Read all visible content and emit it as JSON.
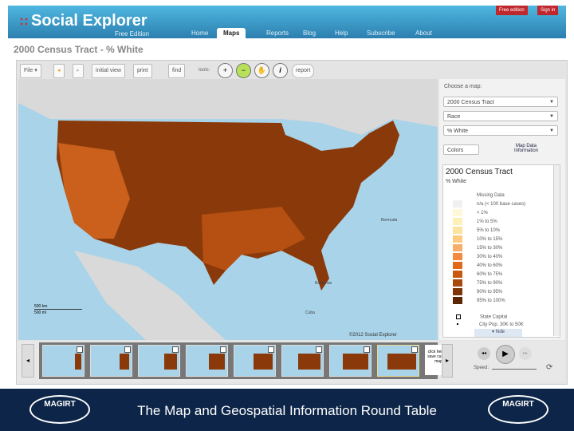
{
  "header": {
    "logo": "Social Explorer",
    "edition": "Free Edition",
    "nav": [
      "Home",
      "Maps",
      "Reports",
      "Blog",
      "Help",
      "Subscribe",
      "About"
    ],
    "active_nav": "Maps",
    "buttons": [
      "Free edition",
      "Sign in"
    ]
  },
  "page_title": "2000 Census Tract - % White",
  "toolbar": {
    "file": "File",
    "initial_view": "initial view",
    "print": "print",
    "find": "find",
    "tools": "tools:",
    "report": "report",
    "tools_icons": [
      "zoom-in-icon",
      "zoom-out-icon",
      "pan-hand-icon",
      "info-icon"
    ]
  },
  "map": {
    "labels": {
      "bermuda": "Bermuda",
      "bahamas": "Bahamas",
      "cuba": "Cuba",
      "scale_km": "500 km",
      "scale_mi": "500 mi",
      "copyright": "©2012 Social Explorer"
    },
    "colors": {
      "ocean": "#a9d3e8",
      "land": "#d9d9d9",
      "fill": "#8a3a0a"
    }
  },
  "side": {
    "choose": "Choose a map:",
    "selects": [
      "2000 Census Tract",
      "Race",
      "% White"
    ],
    "colors_btn": "Colors",
    "map_data_info": "Map Data Information",
    "legend": {
      "title": "2000 Census Tract",
      "subtitle": "% White",
      "items": [
        {
          "label": "Missing Data",
          "color": "#ffffff"
        },
        {
          "label": "n/a (< 100 base cases)",
          "color": "#f0f0f0"
        },
        {
          "label": "< 1%",
          "color": "#fff8d8"
        },
        {
          "label": "1% to 5%",
          "color": "#fff0b8"
        },
        {
          "label": "5% to 10%",
          "color": "#fde3a0"
        },
        {
          "label": "10% to 15%",
          "color": "#fccb80"
        },
        {
          "label": "15% to 30%",
          "color": "#f8ad68"
        },
        {
          "label": "30% to 40%",
          "color": "#f48a40"
        },
        {
          "label": "40% to 60%",
          "color": "#e06a18"
        },
        {
          "label": "60% to 75%",
          "color": "#c85a10"
        },
        {
          "label": "75% to 90%",
          "color": "#a84a0c"
        },
        {
          "label": "90% to 95%",
          "color": "#7e3608"
        },
        {
          "label": "95% to 100%",
          "color": "#5a2604"
        }
      ],
      "state_capital": "State Capital",
      "city_pop": "City Pop. 30K to 50K",
      "hide": "hide"
    }
  },
  "filmstrip": {
    "click_text": "click here to save current map",
    "speed": "Speed:"
  },
  "footer": {
    "text": "The Map and Geospatial Information Round Table",
    "seal": "MAGIRT"
  }
}
